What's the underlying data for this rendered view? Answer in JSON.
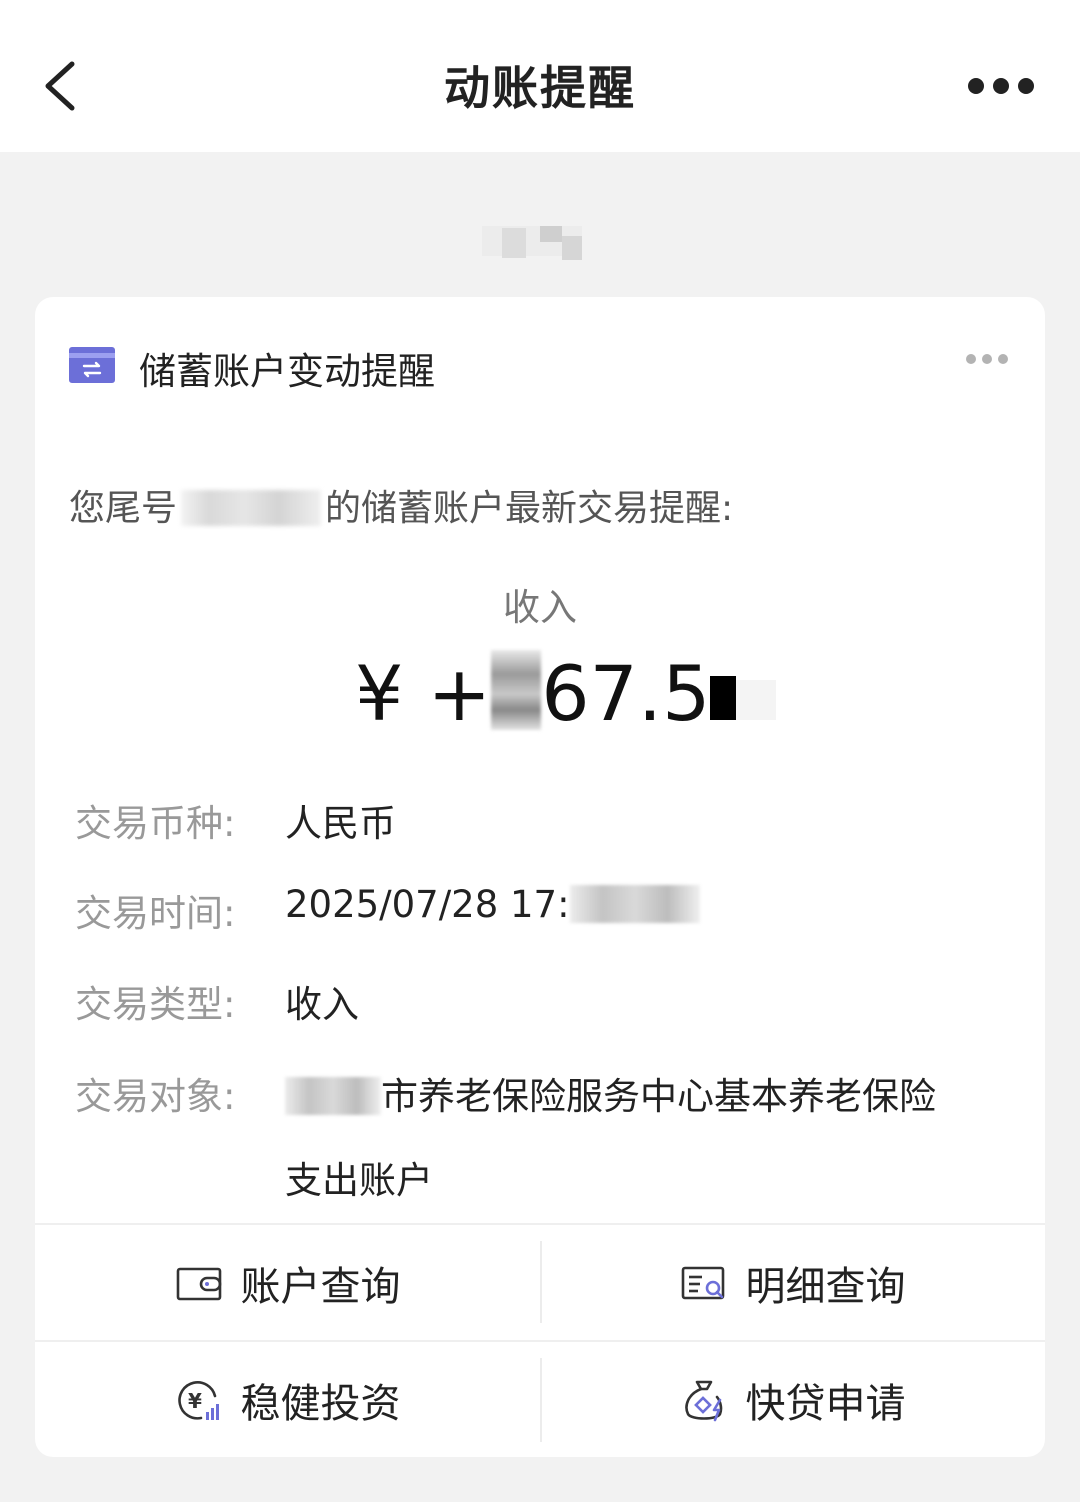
{
  "nav": {
    "title": "动账提醒",
    "back_icon": "chevron-left-icon",
    "more_icon": "more-horizontal-icon"
  },
  "card": {
    "title": "储蓄账户变动提醒",
    "header_icon": "transfer-card-icon",
    "intro_prefix": "您尾号",
    "intro_suffix": "的储蓄账户最新交易提醒:",
    "tx_label": "收入",
    "amount_prefix": "¥ +",
    "amount_visible": "67.5",
    "details": [
      {
        "key": "交易币种:",
        "value": "人民币"
      },
      {
        "key": "交易时间:",
        "value": "2025/07/28 17:"
      },
      {
        "key": "交易类型:",
        "value": "收入"
      },
      {
        "key": "交易对象:",
        "value": "市养老保险服务中心基本养老保险",
        "value_line2": "支出账户"
      }
    ],
    "actions": [
      {
        "label": "账户查询",
        "icon": "wallet-icon"
      },
      {
        "label": "明细查询",
        "icon": "statement-search-icon"
      },
      {
        "label": "稳健投资",
        "icon": "yuan-investment-icon"
      },
      {
        "label": "快贷申请",
        "icon": "money-bag-loan-icon"
      }
    ]
  },
  "colors": {
    "accent_icon": "#6c6fd8",
    "page_bg": "#f2f2f2",
    "card_bg": "#ffffff",
    "label_gray": "#999999"
  }
}
